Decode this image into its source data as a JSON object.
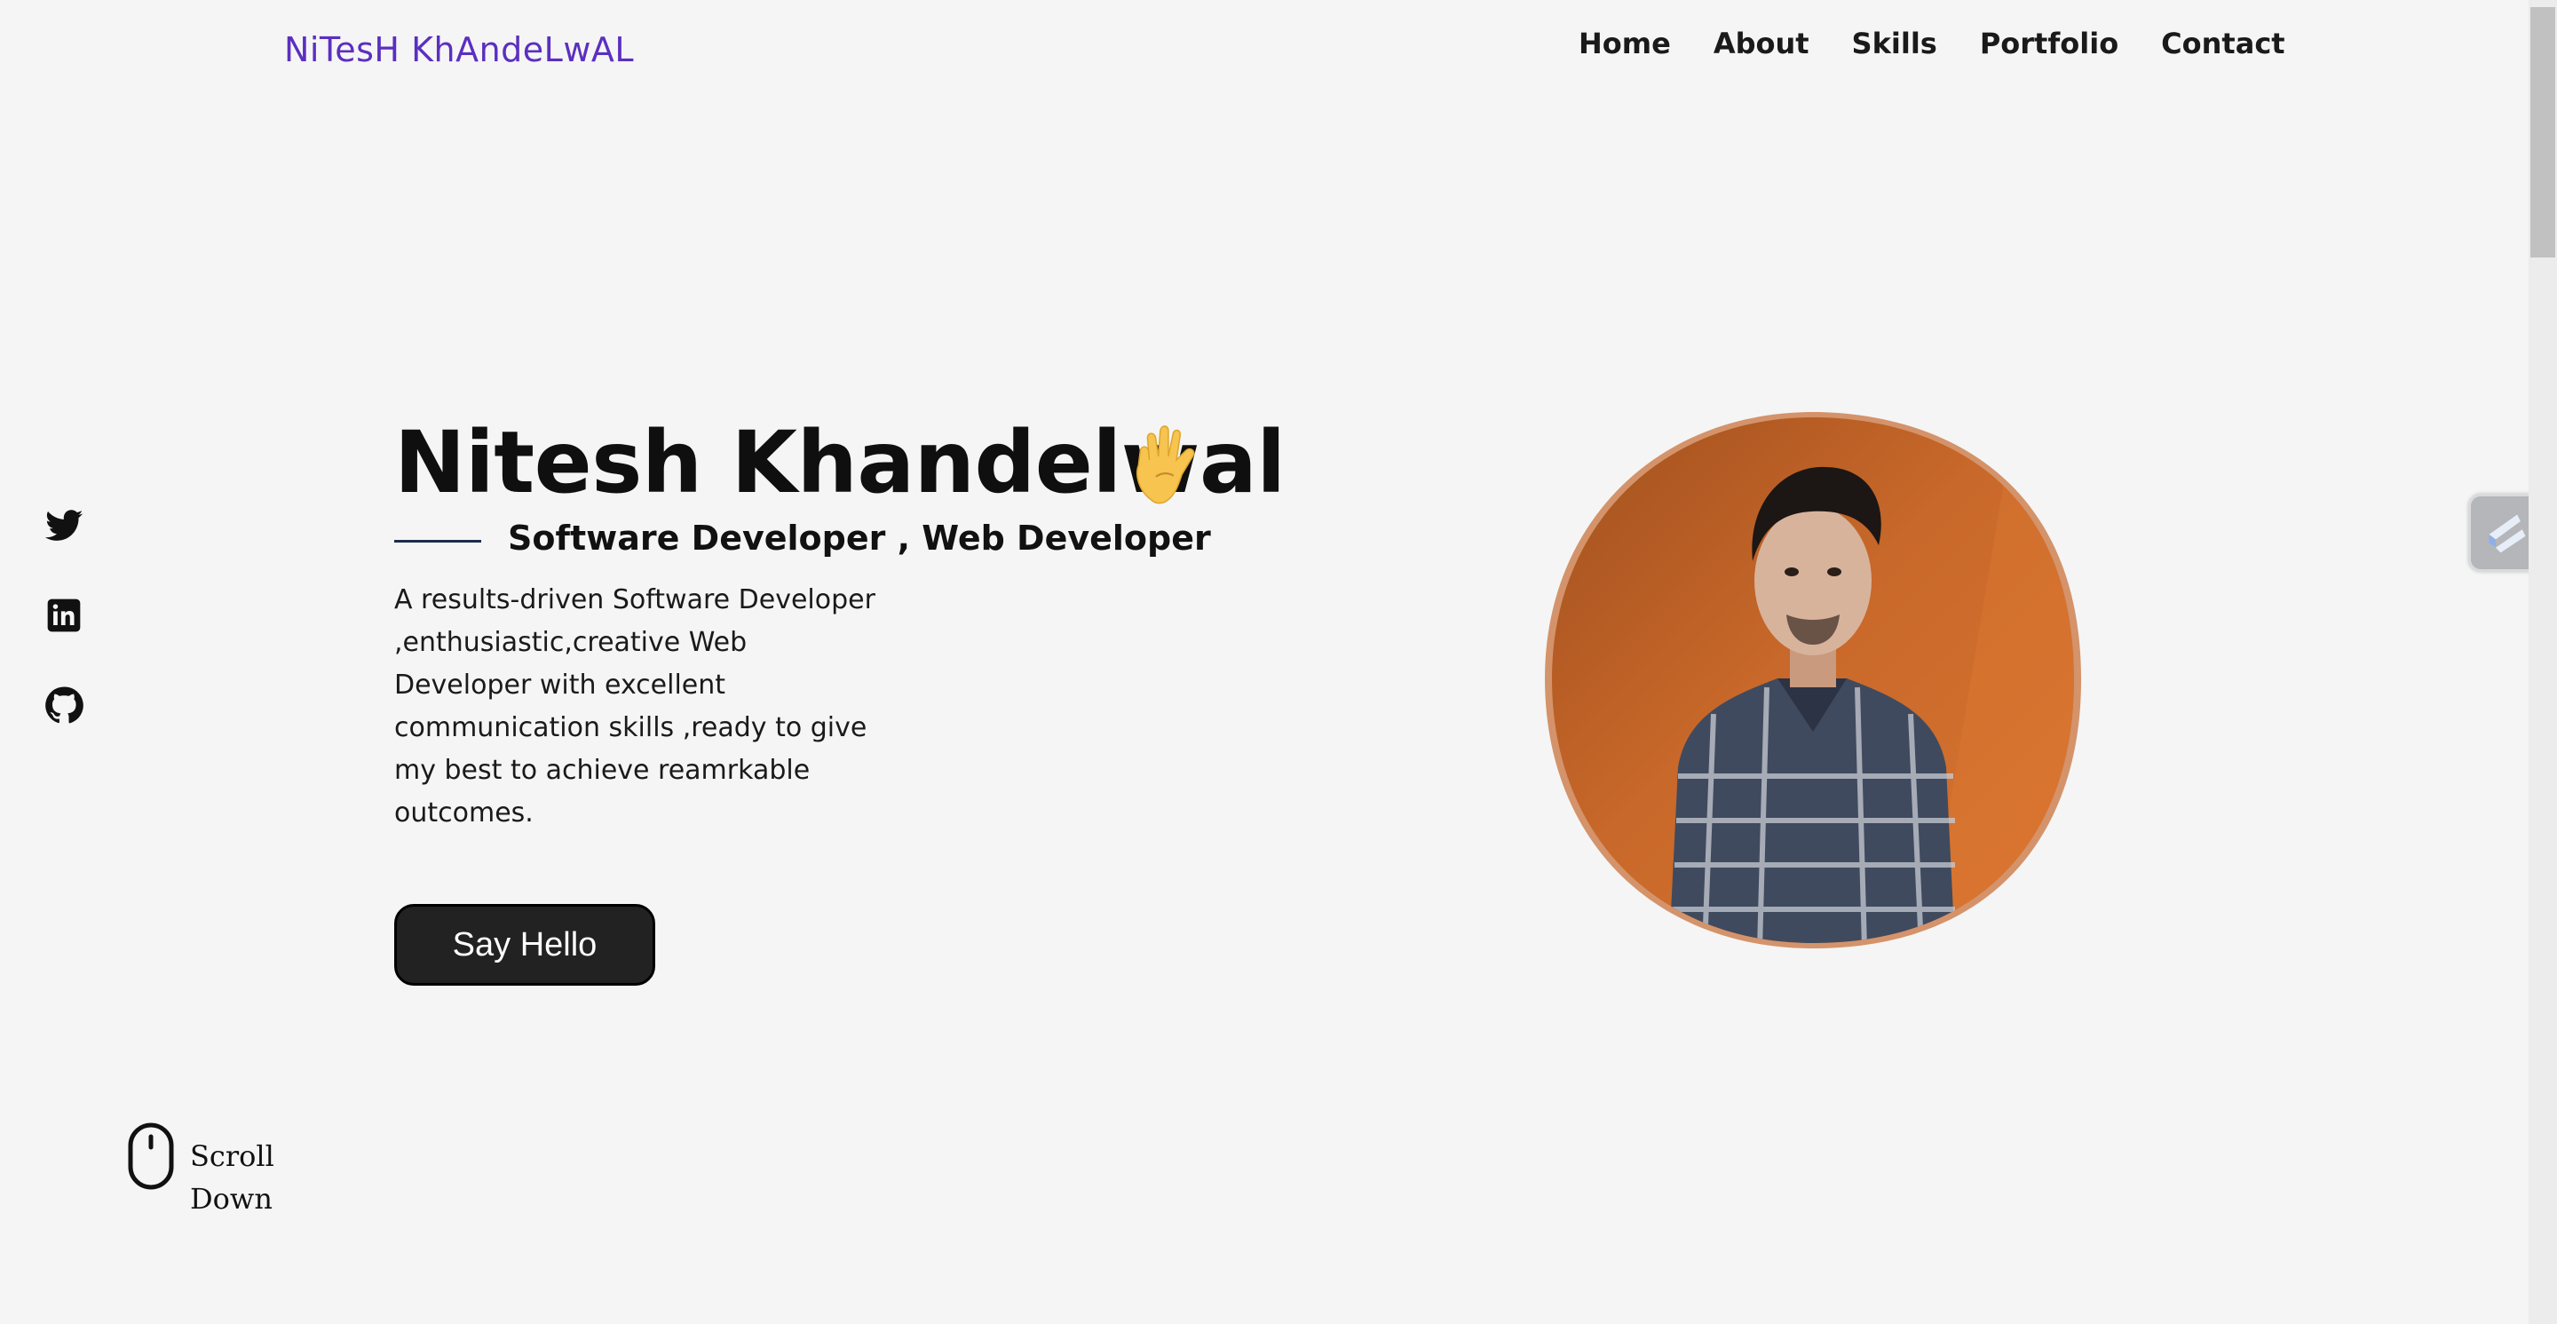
{
  "brand": {
    "name": "NiTesH KhAndeLwAL"
  },
  "nav": {
    "items": [
      {
        "label": "Home"
      },
      {
        "label": "About"
      },
      {
        "label": "Skills"
      },
      {
        "label": "Portfolio"
      },
      {
        "label": "Contact"
      }
    ]
  },
  "social": [
    {
      "icon": "twitter-icon"
    },
    {
      "icon": "linkedin-icon"
    },
    {
      "icon": "github-icon"
    }
  ],
  "hero": {
    "name": "Nitesh Khandelwal",
    "subtitle": "Software Developer , Web Developer",
    "description": "A results-driven Software Developer ,enthusiastic,creative Web Developer with excellent communication skills ,ready to give my best to achieve reamrkable outcomes.",
    "cta_label": "Say Hello"
  },
  "scroll": {
    "line1": "Scroll",
    "line2": "Down"
  },
  "colors": {
    "brand": "#5b2fc0",
    "background": "#f5f5f5",
    "button": "#222222",
    "portrait_bg": "#c8682a"
  }
}
